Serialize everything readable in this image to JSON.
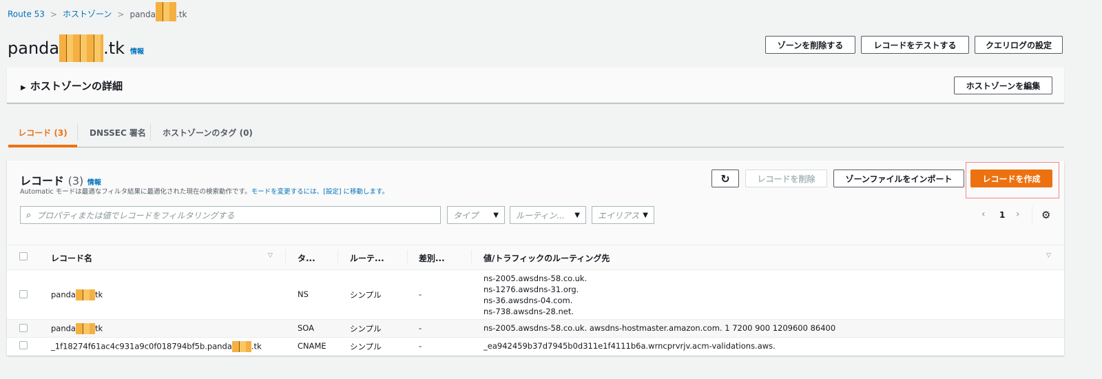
{
  "breadcrumb": {
    "items": [
      "Route 53",
      "ホストゾーン"
    ],
    "current_prefix": "panda",
    "current_suffix": ".tk"
  },
  "header": {
    "title_prefix": "panda",
    "title_suffix": ".tk",
    "info": "情報",
    "buttons": {
      "delete_zone": "ゾーンを削除する",
      "test_record": "レコードをテストする",
      "query_log": "クエリログの設定"
    }
  },
  "details": {
    "title": "ホストゾーンの詳細",
    "edit": "ホストゾーンを編集"
  },
  "tabs": [
    {
      "label": "レコード (3)"
    },
    {
      "label": "DNSSEC 署名"
    },
    {
      "label": "ホストゾーンのタグ (0)"
    }
  ],
  "records": {
    "title": "レコード",
    "count": "(3)",
    "info": "情報",
    "desc": "Automatic モードは最適なフィルタ結果に最適化された現在の検索動作です。",
    "desc_link": "モードを変更するには、[設定] に移動します。",
    "buttons": {
      "delete": "レコードを削除",
      "import": "ゾーンファイルをインポート",
      "create": "レコードを作成"
    },
    "search_placeholder": "プロパティまたは値でレコードをフィルタリングする",
    "filters": [
      "タイプ",
      "ルーティン...",
      "エイリアス"
    ],
    "page": "1",
    "columns": [
      "レコード名",
      "タ...",
      "ルーテ...",
      "差別...",
      "値/トラフィックのルーティング先"
    ],
    "rows": [
      {
        "name_prefix": "panda",
        "name_suffix": "tk",
        "type": "NS",
        "routing": "シンプル",
        "diff": "-",
        "values": [
          "ns-2005.awsdns-58.co.uk.",
          "ns-1276.awsdns-31.org.",
          "ns-36.awsdns-04.com.",
          "ns-738.awsdns-28.net."
        ]
      },
      {
        "name_prefix": "panda",
        "name_suffix": "tk",
        "type": "SOA",
        "routing": "シンプル",
        "diff": "-",
        "values": [
          "ns-2005.awsdns-58.co.uk. awsdns-hostmaster.amazon.com. 1 7200 900 1209600 86400"
        ]
      },
      {
        "name_prefix": "_1f18274f61ac4c931a9c0f018794bf5b.panda",
        "name_suffix": ".tk",
        "type": "CNAME",
        "routing": "シンプル",
        "diff": "-",
        "values": [
          "_ea942459b37d7945b0d311e1f4111b6a.wrncprvrjv.acm-validations.aws."
        ]
      }
    ]
  },
  "colors": {
    "accent": "#ec7211",
    "link": "#0073bb"
  }
}
